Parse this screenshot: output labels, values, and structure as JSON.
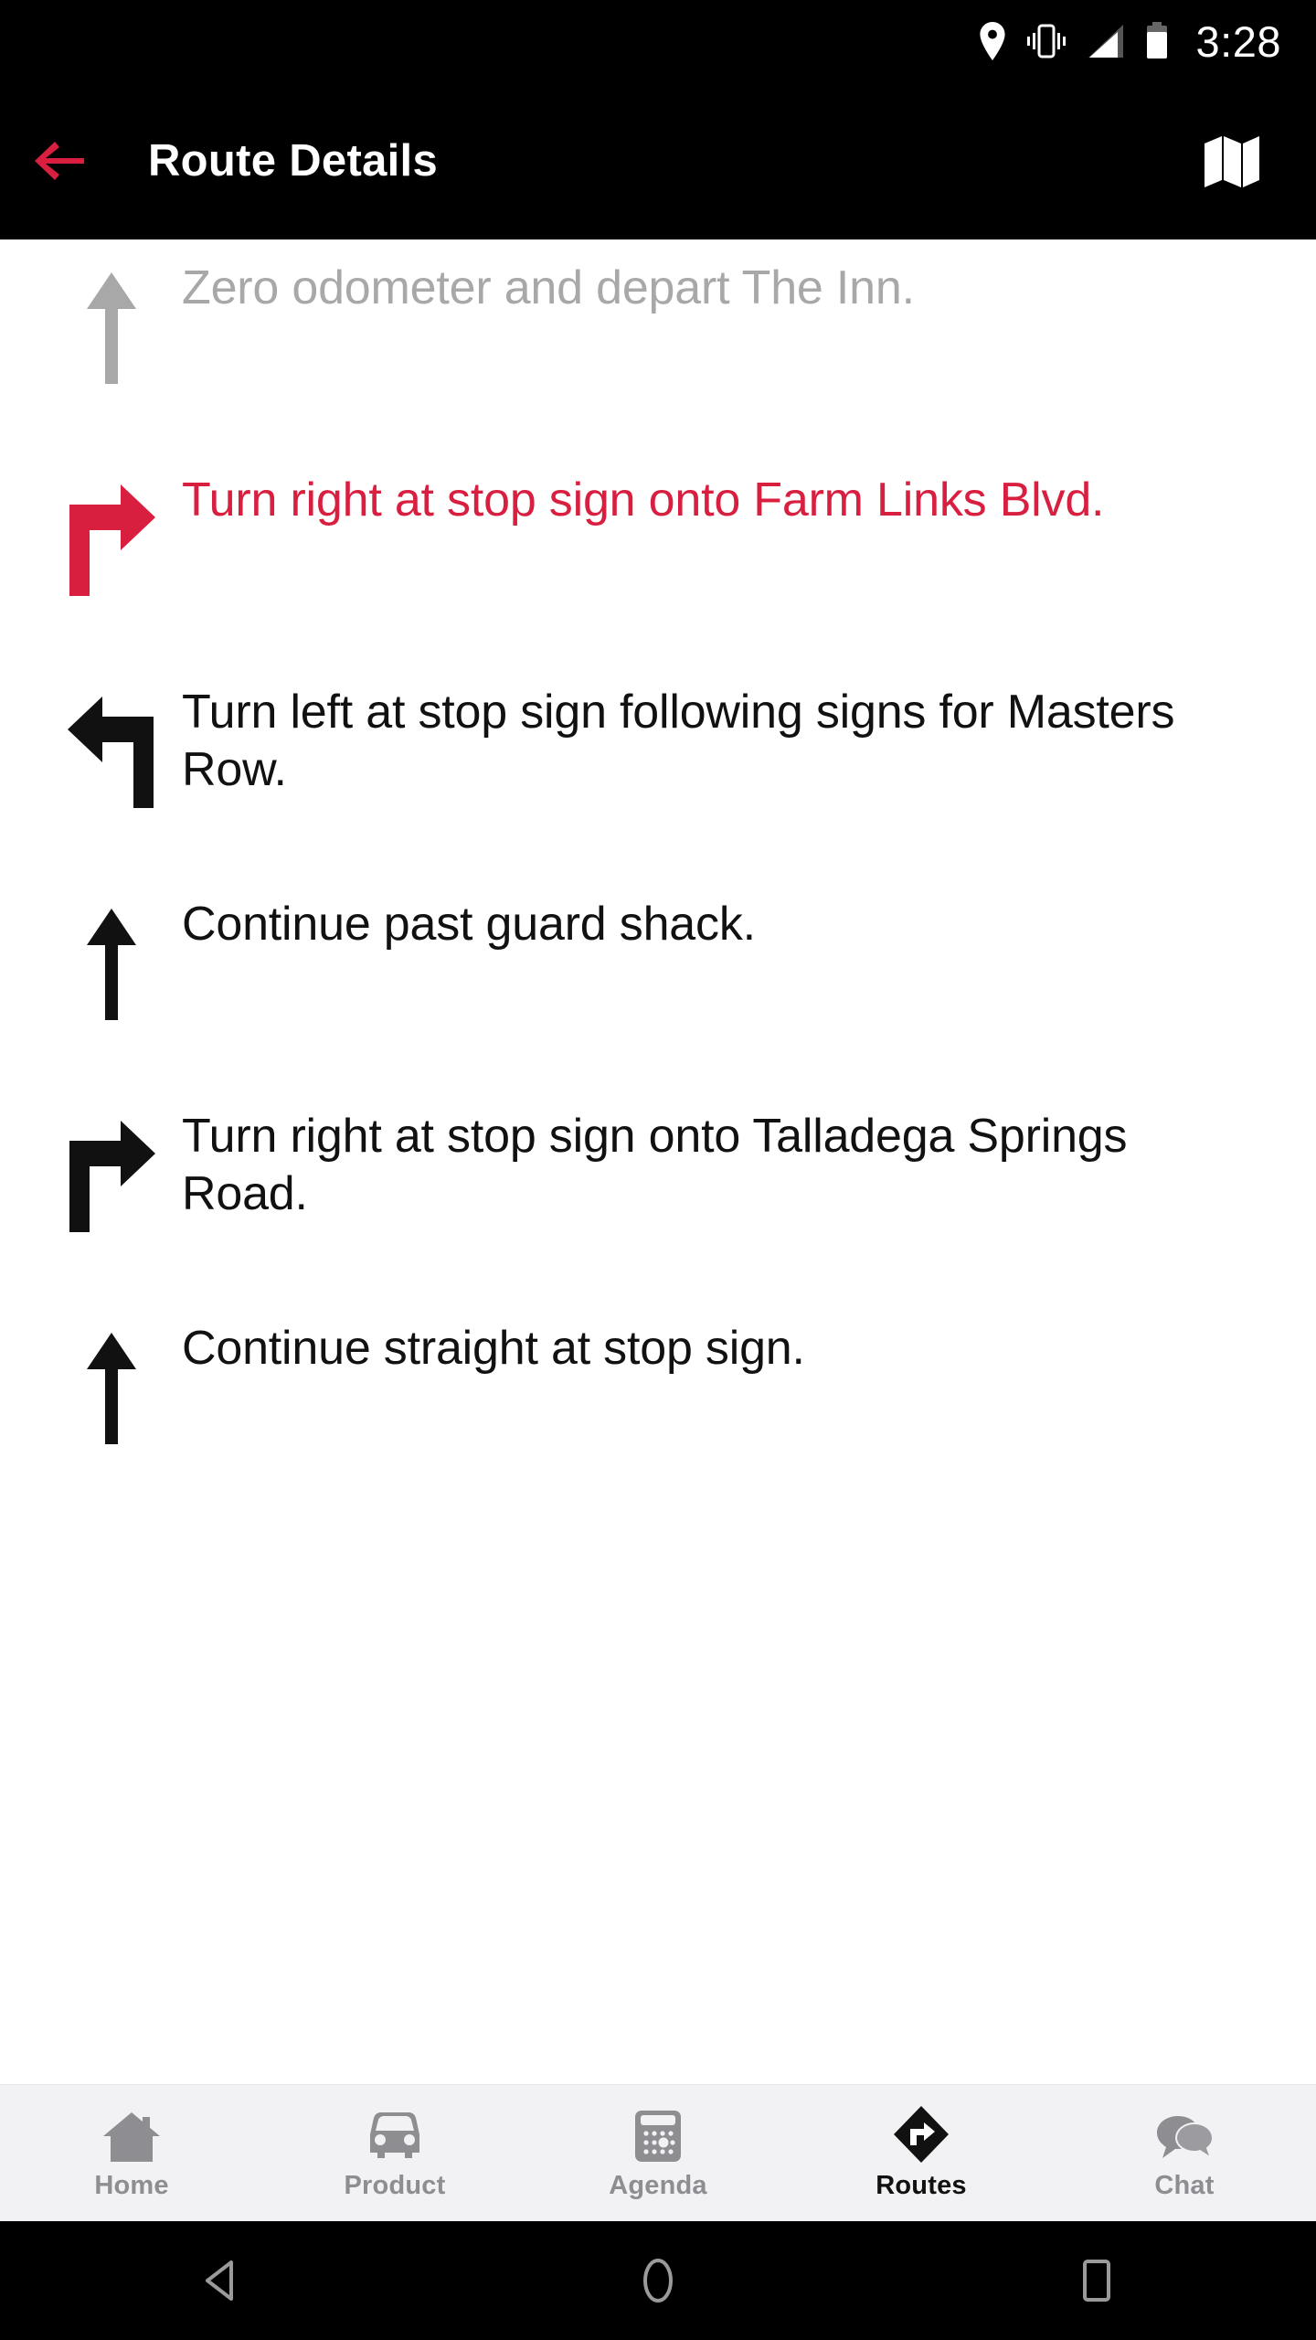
{
  "statusbar": {
    "time": "3:28",
    "icons": [
      "location-pin-icon",
      "vibrate-icon",
      "signal-icon",
      "battery-icon"
    ]
  },
  "appbar": {
    "back_label": "back-arrow",
    "title": "Route Details",
    "map_label": "map-icon",
    "accent_color": "#d81f3f",
    "background": "#000000"
  },
  "route_steps": [
    {
      "icon": "arrow-straight-icon",
      "text": "Zero odometer and depart The Inn.",
      "state": "muted",
      "color": "#a8a8a8"
    },
    {
      "icon": "arrow-turn-right-icon",
      "text": "Turn right at stop sign onto Farm Links Blvd.",
      "state": "active",
      "color": "#d81f3f"
    },
    {
      "icon": "arrow-turn-left-icon",
      "text": "Turn left at stop sign following signs for Masters Row.",
      "state": "normal",
      "color": "#111111"
    },
    {
      "icon": "arrow-straight-icon",
      "text": "Continue past guard shack.",
      "state": "normal",
      "color": "#111111"
    },
    {
      "icon": "arrow-turn-right-icon",
      "text": "Turn right at stop sign onto Talladega Springs Road.",
      "state": "normal",
      "color": "#111111"
    },
    {
      "icon": "arrow-straight-icon",
      "text": "Continue straight at stop sign.",
      "state": "normal",
      "color": "#111111"
    }
  ],
  "bottom_nav": {
    "background": "#f2f2f4",
    "active_index": 3,
    "items": [
      {
        "label": "Home",
        "icon": "home-icon",
        "active": false
      },
      {
        "label": "Product",
        "icon": "car-icon",
        "active": false
      },
      {
        "label": "Agenda",
        "icon": "calendar-icon",
        "active": false
      },
      {
        "label": "Routes",
        "icon": "routes-diamond-icon",
        "active": true
      },
      {
        "label": "Chat",
        "icon": "chat-bubbles-icon",
        "active": false
      }
    ]
  },
  "android_nav": {
    "buttons": [
      "back-triangle-icon",
      "home-circle-icon",
      "recents-square-icon"
    ]
  }
}
